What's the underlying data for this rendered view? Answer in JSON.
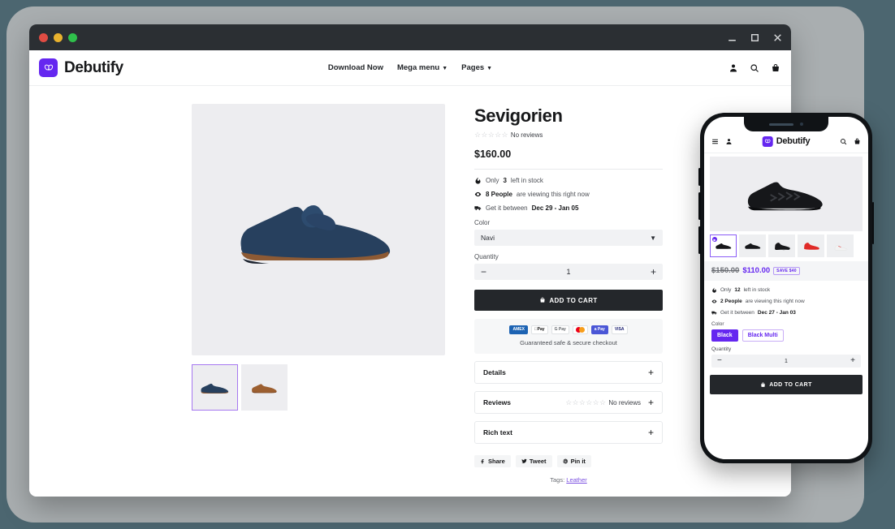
{
  "window": {
    "minimize_label": "minimize",
    "maximize_label": "maximize",
    "close_label": "close"
  },
  "desktop": {
    "brand": "Debutify",
    "nav_links": [
      {
        "label": "Download Now",
        "has_caret": false
      },
      {
        "label": "Mega menu",
        "has_caret": true
      },
      {
        "label": "Pages",
        "has_caret": true
      }
    ],
    "product": {
      "title": "Sevigorien",
      "stars": "☆☆☆☆☆",
      "reviews_text": "No reviews",
      "price": "$160.00",
      "stock_prefix": "Only",
      "stock_count": "3",
      "stock_suffix": "left in stock",
      "viewers_count": "8 People",
      "viewers_suffix": "are viewing this right now",
      "delivery_prefix": "Get it between",
      "delivery_range": "Dec 29 - Jan 05",
      "color_label": "Color",
      "color_value": "Navi",
      "quantity_label": "Quantity",
      "quantity_value": "1",
      "minus": "−",
      "plus": "+",
      "add_to_cart": "ADD TO CART"
    },
    "trust": {
      "payments": [
        "AMEX",
        "Pay",
        "Pay",
        "mastercard",
        "Pay",
        "VISA"
      ],
      "amex_label": "AMEX",
      "apple_pay_label": "Pay",
      "gpay_label": "G Pay",
      "amazon_pay_label": "a Pay",
      "visa_label": "VISA",
      "caption": "Guaranteed safe & secure checkout"
    },
    "accordions": [
      {
        "title": "Details",
        "meta": "",
        "stars": "",
        "toggle": "+"
      },
      {
        "title": "Reviews",
        "meta": "No reviews",
        "stars": "☆☆☆☆☆☆",
        "toggle": "+"
      },
      {
        "title": "Rich text",
        "meta": "",
        "stars": "",
        "toggle": "+"
      }
    ],
    "share": [
      {
        "label": "Share",
        "icon": "facebook-icon"
      },
      {
        "label": "Tweet",
        "icon": "twitter-icon"
      },
      {
        "label": "Pin it",
        "icon": "pinterest-icon"
      }
    ],
    "tags_label": "Tags:",
    "tags_value": "Leather"
  },
  "phone": {
    "brand": "Debutify",
    "product": {
      "old_price": "$150.00",
      "new_price": "$110.00",
      "save_badge": "SAVE $40",
      "stock_prefix": "Only",
      "stock_count": "12",
      "stock_suffix": "left in stock",
      "viewers_count": "2 People",
      "viewers_suffix": "are viewing this right now",
      "delivery_prefix": "Get it between",
      "delivery_range": "Dec 27 - Jan 03",
      "color_label": "Color",
      "swatches": [
        {
          "label": "Black",
          "selected": true
        },
        {
          "label": "Black Multi",
          "selected": false
        }
      ],
      "quantity_label": "Quantity",
      "quantity_value": "1",
      "minus": "−",
      "plus": "+",
      "add_to_cart": "ADD TO CART"
    }
  },
  "colors": {
    "brand_purple": "#6527f0",
    "page_background": "#4c6670",
    "backdrop_gray": "#a9aeb0",
    "dark_button": "#24272b"
  }
}
